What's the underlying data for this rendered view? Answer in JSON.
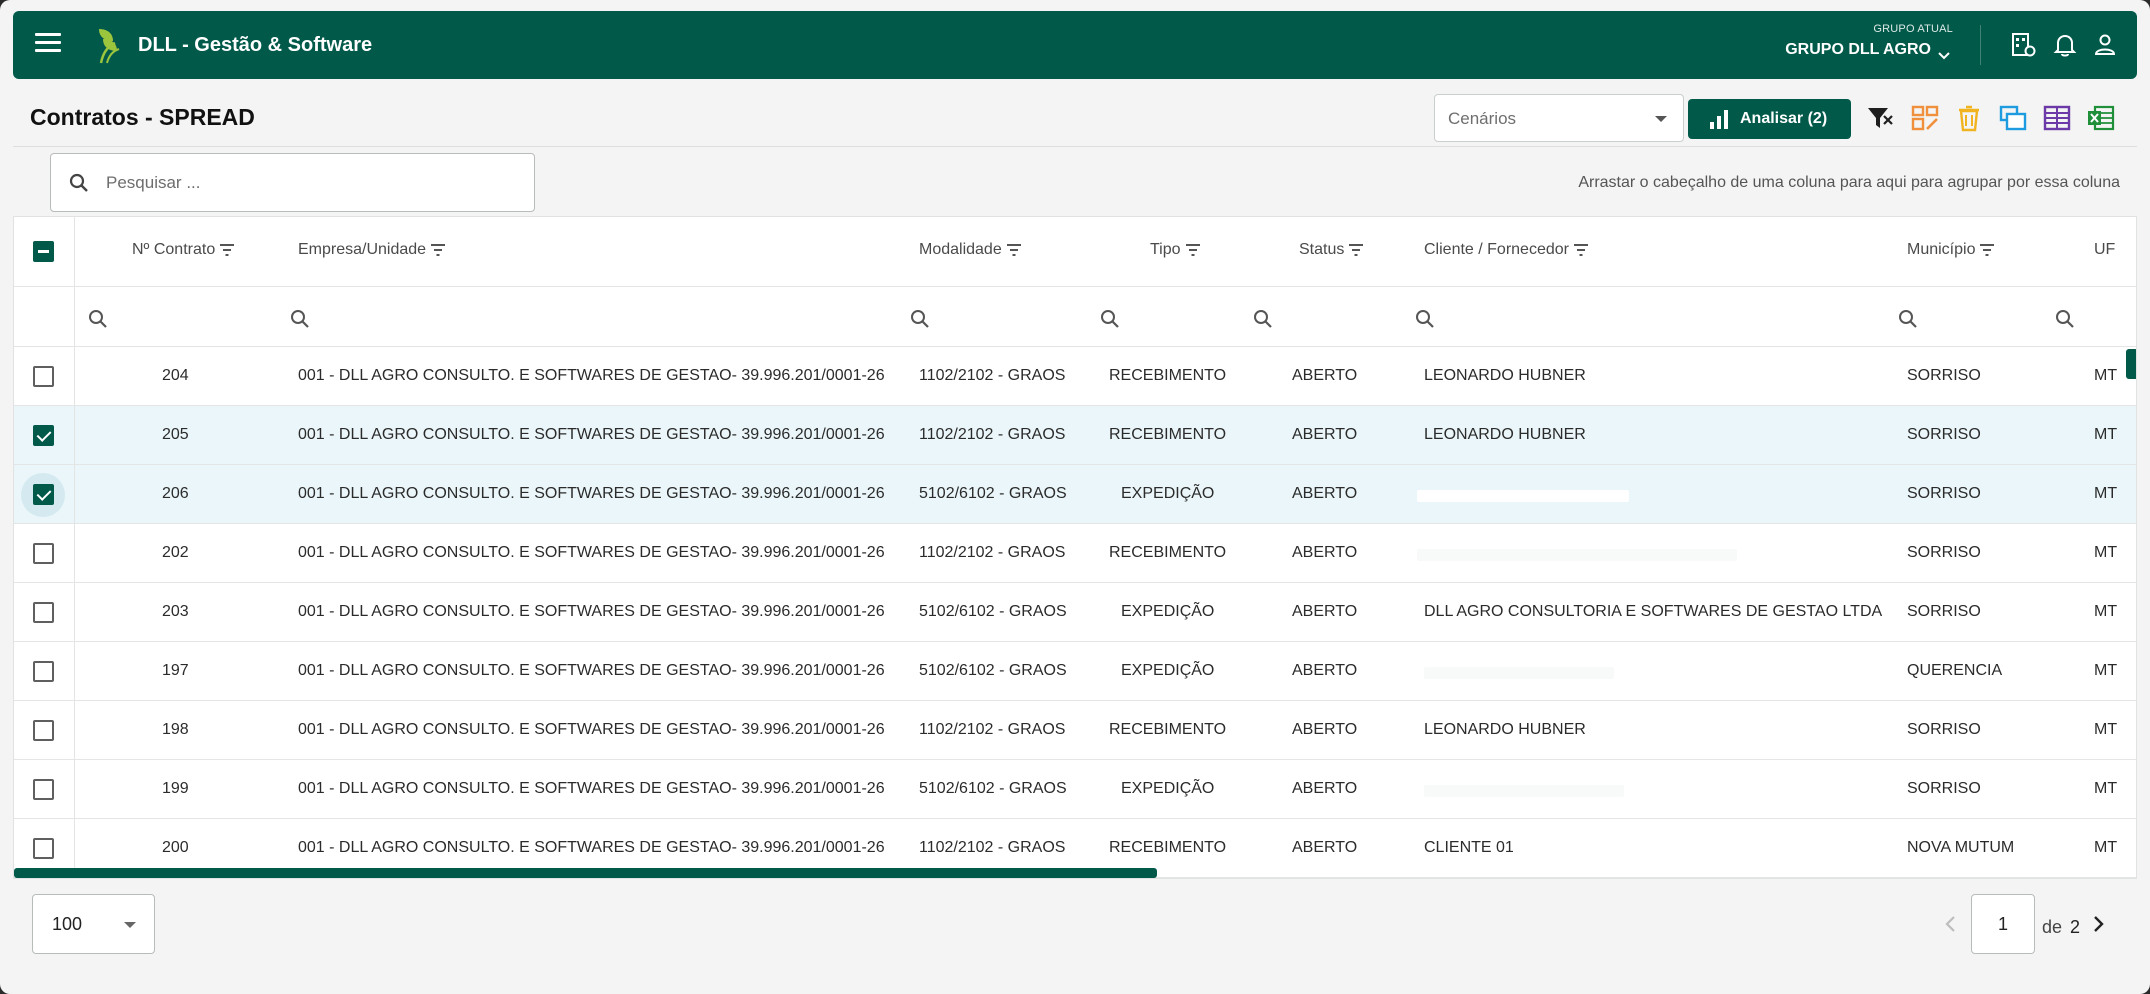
{
  "header": {
    "brand": "DLL - Gestão & Software",
    "group_label": "GRUPO ATUAL",
    "group_value": "GRUPO DLL AGRO"
  },
  "toolbar": {
    "page_title": "Contratos - SPREAD",
    "scenarios_placeholder": "Cenários",
    "analyze_label": "Analisar (2)",
    "icons": [
      "filter-icon",
      "layout-edit-icon",
      "delete-icon",
      "copy-window-icon",
      "columns-icon",
      "excel-export-icon"
    ]
  },
  "search": {
    "placeholder": "Pesquisar ...",
    "group_hint": "Arrastar o cabeçalho de uma coluna para aqui para agrupar por essa coluna"
  },
  "table": {
    "columns": {
      "contract": "Nº Contrato",
      "company": "Empresa/Unidade",
      "modality": "Modalidade",
      "type": "Tipo",
      "status": "Status",
      "client": "Cliente / Fornecedor",
      "city": "Município",
      "uf": "UF"
    },
    "rows": [
      {
        "selected": false,
        "contract": "204",
        "company": "001 - DLL AGRO CONSULTO. E SOFTWARES DE GESTAO- 39.996.201/0001-26",
        "modality": "1102/2102 - GRAOS",
        "type": "RECEBIMENTO",
        "status": "ABERTO",
        "client": "LEONARDO HUBNER",
        "city": "SORRISO",
        "uf": "MT"
      },
      {
        "selected": true,
        "contract": "205",
        "company": "001 - DLL AGRO CONSULTO. E SOFTWARES DE GESTAO- 39.996.201/0001-26",
        "modality": "1102/2102 - GRAOS",
        "type": "RECEBIMENTO",
        "status": "ABERTO",
        "client": "LEONARDO HUBNER",
        "city": "SORRISO",
        "uf": "MT"
      },
      {
        "selected": true,
        "contract": "206",
        "company": "001 - DLL AGRO CONSULTO. E SOFTWARES DE GESTAO- 39.996.201/0001-26",
        "modality": "5102/6102 - GRAOS",
        "type": "EXPEDIÇÃO",
        "status": "ABERTO",
        "client": "",
        "city": "SORRISO",
        "uf": "MT"
      },
      {
        "selected": false,
        "contract": "202",
        "company": "001 - DLL AGRO CONSULTO. E SOFTWARES DE GESTAO- 39.996.201/0001-26",
        "modality": "1102/2102 - GRAOS",
        "type": "RECEBIMENTO",
        "status": "ABERTO",
        "client": "",
        "city": "SORRISO",
        "uf": "MT"
      },
      {
        "selected": false,
        "contract": "203",
        "company": "001 - DLL AGRO CONSULTO. E SOFTWARES DE GESTAO- 39.996.201/0001-26",
        "modality": "5102/6102 - GRAOS",
        "type": "EXPEDIÇÃO",
        "status": "ABERTO",
        "client": "DLL AGRO CONSULTORIA E SOFTWARES DE GESTAO LTDA",
        "city": "SORRISO",
        "uf": "MT"
      },
      {
        "selected": false,
        "contract": "197",
        "company": "001 - DLL AGRO CONSULTO. E SOFTWARES DE GESTAO- 39.996.201/0001-26",
        "modality": "5102/6102 - GRAOS",
        "type": "EXPEDIÇÃO",
        "status": "ABERTO",
        "client": "",
        "city": "QUERENCIA",
        "uf": "MT"
      },
      {
        "selected": false,
        "contract": "198",
        "company": "001 - DLL AGRO CONSULTO. E SOFTWARES DE GESTAO- 39.996.201/0001-26",
        "modality": "1102/2102 - GRAOS",
        "type": "RECEBIMENTO",
        "status": "ABERTO",
        "client": "LEONARDO HUBNER",
        "city": "SORRISO",
        "uf": "MT"
      },
      {
        "selected": false,
        "contract": "199",
        "company": "001 - DLL AGRO CONSULTO. E SOFTWARES DE GESTAO- 39.996.201/0001-26",
        "modality": "5102/6102 - GRAOS",
        "type": "EXPEDIÇÃO",
        "status": "ABERTO",
        "client": "",
        "city": "SORRISO",
        "uf": "MT"
      },
      {
        "selected": false,
        "contract": "200",
        "company": "001 - DLL AGRO CONSULTO. E SOFTWARES DE GESTAO- 39.996.201/0001-26",
        "modality": "1102/2102 - GRAOS",
        "type": "RECEBIMENTO",
        "status": "ABERTO",
        "client": "CLIENTE 01",
        "city": "NOVA MUTUM",
        "uf": "MT"
      }
    ]
  },
  "pagination": {
    "page_size": "100",
    "current_page": "1",
    "of_label": "de",
    "total_pages": "2"
  },
  "colors": {
    "brand": "#01594a",
    "selected_row": "#eaf6f9"
  }
}
